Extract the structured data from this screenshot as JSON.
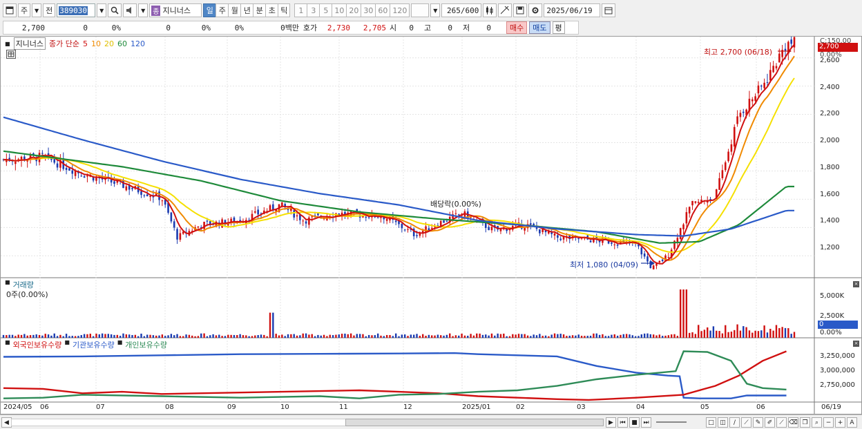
{
  "toolbar": {
    "mode_label": "주",
    "prev_label": "전",
    "stock_code": "389030",
    "stock_tag": "종",
    "stock_name": "지니너스",
    "periods": [
      "일",
      "주",
      "월",
      "년",
      "분",
      "초",
      "틱"
    ],
    "selected_period": "일",
    "interval_numbers": [
      "1",
      "3",
      "5",
      "10",
      "20",
      "30",
      "60",
      "120"
    ],
    "bar_count": "265",
    "bar_total": "/600",
    "date": "2025/06/19"
  },
  "quote": {
    "price": "2,700",
    "change": "0",
    "change_pct": "0%",
    "volume": "0",
    "vol_pct": "0%",
    "ratio_pct": "0%",
    "amount": "0백만",
    "ask_label": "호가",
    "ask": "2,730",
    "bid": "2,705",
    "open_label": "시",
    "open": "0",
    "high_label": "고",
    "high": "0",
    "low_label": "저",
    "low": "0",
    "buy_label": "매수",
    "sell_label": "매도",
    "flat_label": "평"
  },
  "price_pane": {
    "name": "지니너스",
    "ma_label": "종가 단순",
    "ma_periods": [
      {
        "p": "5",
        "color": "#d01010"
      },
      {
        "p": "10",
        "color": "#f08a00"
      },
      {
        "p": "20",
        "color": "#f0d000"
      },
      {
        "p": "60",
        "color": "#1e8a3a"
      },
      {
        "p": "120",
        "color": "#2a5ac8"
      }
    ],
    "high_note": "최고 2,700 (06/18)",
    "low_note": "최저 1,080 (04/09)",
    "dividend_note": "배당락(0.00%)",
    "axis_ticks": [
      "2,600",
      "2,400",
      "2,200",
      "2,000",
      "1,800",
      "1,600",
      "1,400",
      "1,200"
    ],
    "top_label": "C:150.00",
    "current_label": "2,700",
    "pct_label": "0.00%"
  },
  "volume_pane": {
    "title": "거래량",
    "sub": "0주(0.00%)",
    "axis_ticks": [
      "5,000K",
      "2,500K"
    ],
    "current_label": "0",
    "pct_label": "0.00%"
  },
  "holding_pane": {
    "series": [
      {
        "name": "외국인보유수량",
        "color": "#d01010"
      },
      {
        "name": "기관보유수량",
        "color": "#2a5ac8"
      },
      {
        "name": "개인보유수량",
        "color": "#2e8b57"
      }
    ],
    "axis_ticks": [
      "3,250,000",
      "3,000,000",
      "2,750,000"
    ]
  },
  "x_axis": [
    "2024/05",
    "06",
    "07",
    "08",
    "09",
    "10",
    "11",
    "12",
    "2025/01",
    "02",
    "03",
    "04",
    "05",
    "06",
    "06/19"
  ],
  "chart_data": {
    "type": "candlestick",
    "price_ylim": [
      1050,
      2750
    ],
    "price_path": [
      [
        0,
        1880
      ],
      [
        0.05,
        1900
      ],
      [
        0.1,
        1780
      ],
      [
        0.15,
        1700
      ],
      [
        0.2,
        1610
      ],
      [
        0.22,
        1330
      ],
      [
        0.25,
        1420
      ],
      [
        0.3,
        1450
      ],
      [
        0.35,
        1560
      ],
      [
        0.38,
        1450
      ],
      [
        0.42,
        1500
      ],
      [
        0.48,
        1480
      ],
      [
        0.52,
        1350
      ],
      [
        0.55,
        1430
      ],
      [
        0.58,
        1500
      ],
      [
        0.62,
        1380
      ],
      [
        0.66,
        1420
      ],
      [
        0.7,
        1330
      ],
      [
        0.75,
        1310
      ],
      [
        0.8,
        1280
      ],
      [
        0.82,
        1110
      ],
      [
        0.84,
        1200
      ],
      [
        0.87,
        1560
      ],
      [
        0.9,
        1620
      ],
      [
        0.93,
        2200
      ],
      [
        0.96,
        2400
      ],
      [
        0.99,
        2700
      ]
    ],
    "ma120_path": [
      [
        0,
        2180
      ],
      [
        0.1,
        2020
      ],
      [
        0.2,
        1870
      ],
      [
        0.3,
        1740
      ],
      [
        0.4,
        1640
      ],
      [
        0.5,
        1560
      ],
      [
        0.6,
        1450
      ],
      [
        0.7,
        1390
      ],
      [
        0.8,
        1350
      ],
      [
        0.86,
        1340
      ],
      [
        0.92,
        1390
      ],
      [
        0.99,
        1520
      ]
    ],
    "ma60_path": [
      [
        0,
        1940
      ],
      [
        0.15,
        1830
      ],
      [
        0.25,
        1730
      ],
      [
        0.35,
        1590
      ],
      [
        0.45,
        1510
      ],
      [
        0.55,
        1460
      ],
      [
        0.65,
        1420
      ],
      [
        0.75,
        1370
      ],
      [
        0.83,
        1290
      ],
      [
        0.88,
        1300
      ],
      [
        0.93,
        1420
      ],
      [
        0.99,
        1690
      ]
    ]
  }
}
